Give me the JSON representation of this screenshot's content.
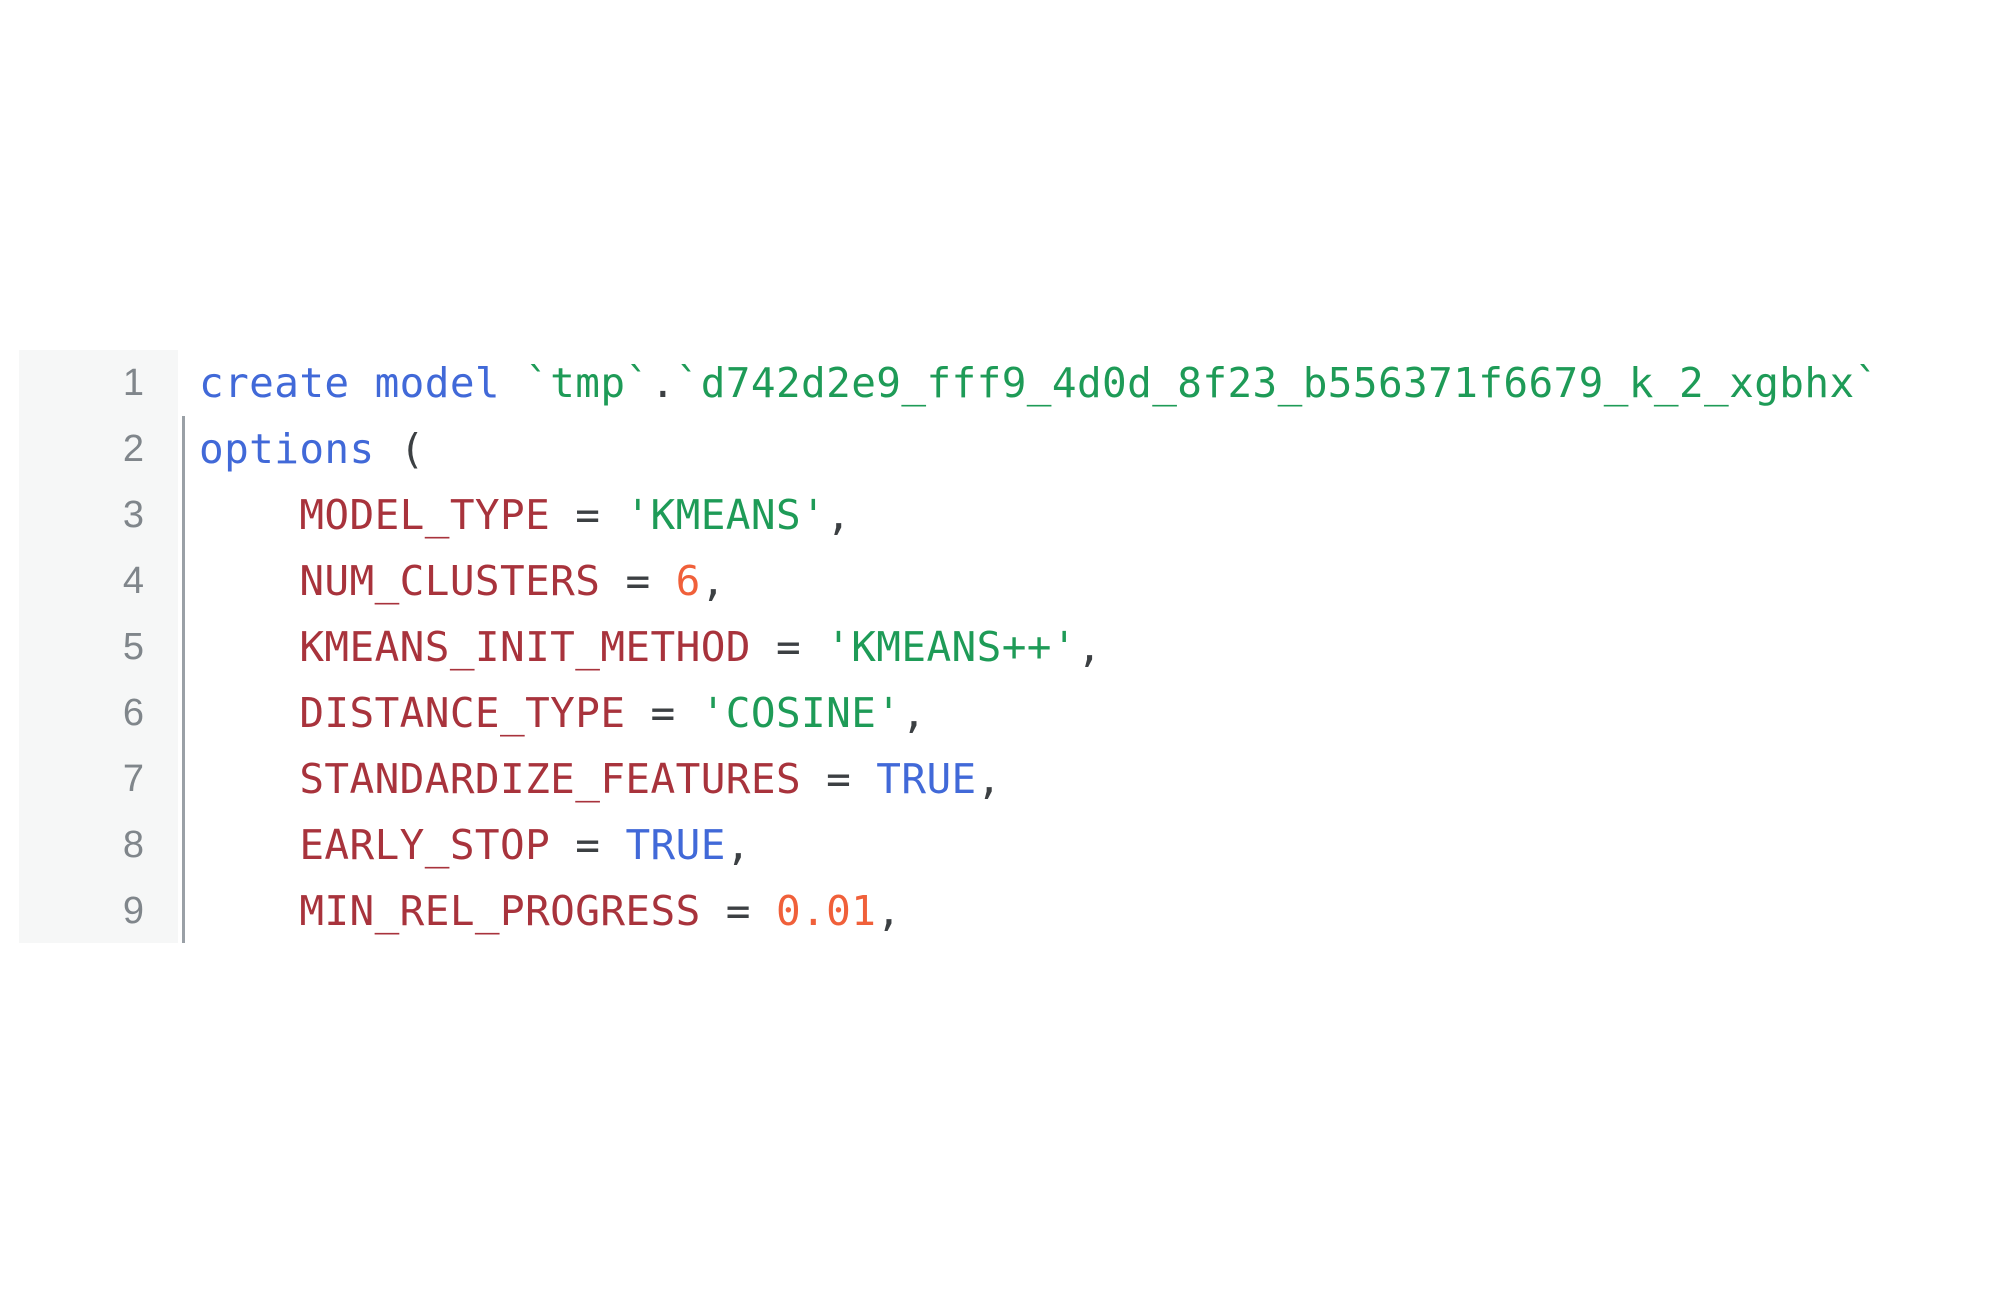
{
  "editor": {
    "language": "sql",
    "gutter_bg": "#f6f7f7",
    "background": "#ffffff",
    "colors": {
      "keyword": "#4169d8",
      "string": "#1e9b57",
      "option_key": "#a8333c",
      "number": "#f0603a",
      "boolean": "#4169d8",
      "punctuation": "#3c4043",
      "line_number": "#80868b",
      "indent_guide": "#9aa0a6"
    },
    "lines": [
      {
        "number": "1",
        "text": "create model `tmp`.`d742d2e9_fff9_4d0d_8f23_b556371f6679_k_2_xgbhx`",
        "tokens": [
          {
            "t": "create model ",
            "c": "keyword"
          },
          {
            "t": "`tmp`",
            "c": "string"
          },
          {
            "t": ".",
            "c": "punct"
          },
          {
            "t": "`d742d2e9_fff9_4d0d_8f23_b556371f6679_k_2_xgbhx`",
            "c": "string"
          }
        ]
      },
      {
        "number": "2",
        "text": "options (",
        "tokens": [
          {
            "t": "options ",
            "c": "keyword"
          },
          {
            "t": "(",
            "c": "punct"
          }
        ]
      },
      {
        "number": "3",
        "text": "    MODEL_TYPE = 'KMEANS',",
        "tokens": [
          {
            "t": "    ",
            "c": "plain"
          },
          {
            "t": "MODEL_TYPE",
            "c": "option"
          },
          {
            "t": " = ",
            "c": "punct"
          },
          {
            "t": "'KMEANS'",
            "c": "string"
          },
          {
            "t": ",",
            "c": "punct"
          }
        ]
      },
      {
        "number": "4",
        "text": "    NUM_CLUSTERS = 6,",
        "tokens": [
          {
            "t": "    ",
            "c": "plain"
          },
          {
            "t": "NUM_CLUSTERS",
            "c": "option"
          },
          {
            "t": " = ",
            "c": "punct"
          },
          {
            "t": "6",
            "c": "number"
          },
          {
            "t": ",",
            "c": "punct"
          }
        ]
      },
      {
        "number": "5",
        "text": "    KMEANS_INIT_METHOD = 'KMEANS++',",
        "tokens": [
          {
            "t": "    ",
            "c": "plain"
          },
          {
            "t": "KMEANS_INIT_METHOD",
            "c": "option"
          },
          {
            "t": " = ",
            "c": "punct"
          },
          {
            "t": "'KMEANS++'",
            "c": "string"
          },
          {
            "t": ",",
            "c": "punct"
          }
        ]
      },
      {
        "number": "6",
        "text": "    DISTANCE_TYPE = 'COSINE',",
        "tokens": [
          {
            "t": "    ",
            "c": "plain"
          },
          {
            "t": "DISTANCE_TYPE",
            "c": "option"
          },
          {
            "t": " = ",
            "c": "punct"
          },
          {
            "t": "'COSINE'",
            "c": "string"
          },
          {
            "t": ",",
            "c": "punct"
          }
        ]
      },
      {
        "number": "7",
        "text": "    STANDARDIZE_FEATURES = TRUE,",
        "tokens": [
          {
            "t": "    ",
            "c": "plain"
          },
          {
            "t": "STANDARDIZE_FEATURES",
            "c": "option"
          },
          {
            "t": " = ",
            "c": "punct"
          },
          {
            "t": "TRUE",
            "c": "bool"
          },
          {
            "t": ",",
            "c": "punct"
          }
        ]
      },
      {
        "number": "8",
        "text": "    EARLY_STOP = TRUE,",
        "tokens": [
          {
            "t": "    ",
            "c": "plain"
          },
          {
            "t": "EARLY_STOP",
            "c": "option"
          },
          {
            "t": " = ",
            "c": "punct"
          },
          {
            "t": "TRUE",
            "c": "bool"
          },
          {
            "t": ",",
            "c": "punct"
          }
        ]
      },
      {
        "number": "9",
        "text": "    MIN_REL_PROGRESS = 0.01,",
        "tokens": [
          {
            "t": "    ",
            "c": "plain"
          },
          {
            "t": "MIN_REL_PROGRESS",
            "c": "option"
          },
          {
            "t": " = ",
            "c": "punct"
          },
          {
            "t": "0.01",
            "c": "number"
          },
          {
            "t": ",",
            "c": "punct"
          }
        ]
      }
    ]
  }
}
